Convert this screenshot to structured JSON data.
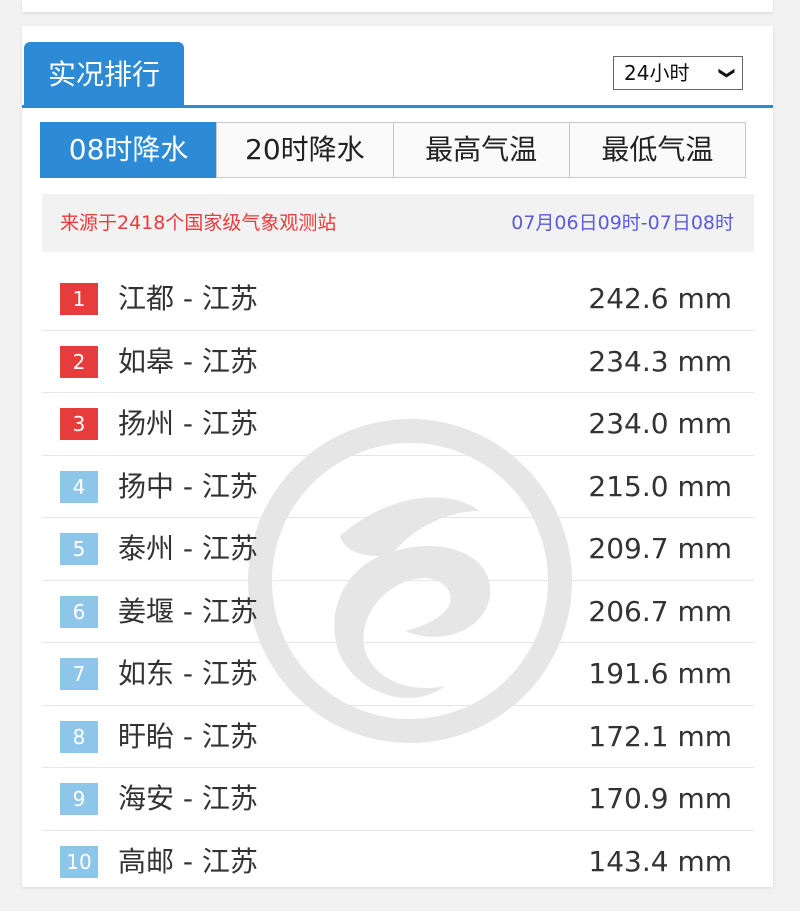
{
  "header": {
    "title": "实况排行"
  },
  "period_select": {
    "value": "24小时"
  },
  "tabs": [
    {
      "label": "08时降水",
      "active": true
    },
    {
      "label": "20时降水",
      "active": false
    },
    {
      "label": "最高气温",
      "active": false
    },
    {
      "label": "最低气温",
      "active": false
    }
  ],
  "info": {
    "source": "来源于2418个国家级气象观测站",
    "range": "07月06日09时-07日08时"
  },
  "rankings": [
    {
      "rank": "1",
      "station": "江都 - 江苏",
      "value": "242.6 mm"
    },
    {
      "rank": "2",
      "station": "如皋 - 江苏",
      "value": "234.3 mm"
    },
    {
      "rank": "3",
      "station": "扬州 - 江苏",
      "value": "234.0 mm"
    },
    {
      "rank": "4",
      "station": "扬中 - 江苏",
      "value": "215.0 mm"
    },
    {
      "rank": "5",
      "station": "泰州 - 江苏",
      "value": "209.7 mm"
    },
    {
      "rank": "6",
      "station": "姜堰 - 江苏",
      "value": "206.7 mm"
    },
    {
      "rank": "7",
      "station": "如东 - 江苏",
      "value": "191.6 mm"
    },
    {
      "rank": "8",
      "station": "盱眙 - 江苏",
      "value": "172.1 mm"
    },
    {
      "rank": "9",
      "station": "海安 - 江苏",
      "value": "170.9 mm"
    },
    {
      "rank": "10",
      "station": "高邮 - 江苏",
      "value": "143.4 mm"
    }
  ],
  "colors": {
    "accent": "#2d8ad4",
    "rank_top": "#e73c3c",
    "rank_other": "#8ec6ea",
    "source_text": "#ec3a3a",
    "range_text": "#5b5bdf"
  },
  "icons": {
    "chevron": "chevron-down-icon",
    "watermark": "logo-watermark-icon"
  }
}
